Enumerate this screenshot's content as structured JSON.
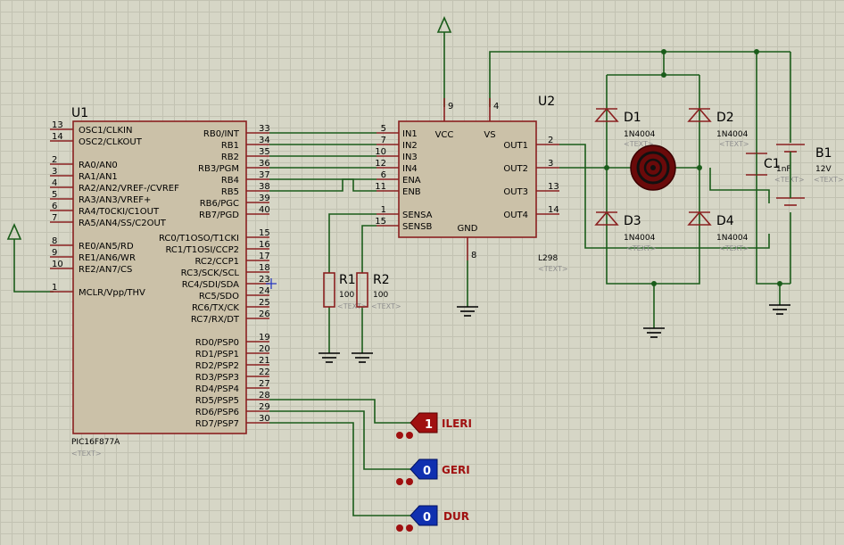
{
  "u1": {
    "ref": "U1",
    "part": "PIC16F877A",
    "text": "<TEXT>",
    "left_pins": [
      {
        "num": "13",
        "label": "OSC1/CLKIN"
      },
      {
        "num": "14",
        "label": "OSC2/CLKOUT"
      },
      {
        "num": "2",
        "label": "RA0/AN0"
      },
      {
        "num": "3",
        "label": "RA1/AN1"
      },
      {
        "num": "4",
        "label": "RA2/AN2/VREF-/CVREF"
      },
      {
        "num": "5",
        "label": "RA3/AN3/VREF+"
      },
      {
        "num": "6",
        "label": "RA4/T0CKI/C1OUT"
      },
      {
        "num": "7",
        "label": "RA5/AN4/SS/C2OUT"
      },
      {
        "num": "8",
        "label": "RE0/AN5/RD"
      },
      {
        "num": "9",
        "label": "RE1/AN6/WR"
      },
      {
        "num": "10",
        "label": "RE2/AN7/CS"
      },
      {
        "num": "1",
        "label": "MCLR/Vpp/THV"
      }
    ],
    "right_pins": [
      {
        "num": "33",
        "label": "RB0/INT"
      },
      {
        "num": "34",
        "label": "RB1"
      },
      {
        "num": "35",
        "label": "RB2"
      },
      {
        "num": "36",
        "label": "RB3/PGM"
      },
      {
        "num": "37",
        "label": "RB4"
      },
      {
        "num": "38",
        "label": "RB5"
      },
      {
        "num": "39",
        "label": "RB6/PGC"
      },
      {
        "num": "40",
        "label": "RB7/PGD"
      },
      {
        "num": "15",
        "label": "RC0/T1OSO/T1CKI"
      },
      {
        "num": "16",
        "label": "RC1/T1OSI/CCP2"
      },
      {
        "num": "17",
        "label": "RC2/CCP1"
      },
      {
        "num": "18",
        "label": "RC3/SCK/SCL"
      },
      {
        "num": "23",
        "label": "RC4/SDI/SDA"
      },
      {
        "num": "24",
        "label": "RC5/SDO"
      },
      {
        "num": "25",
        "label": "RC6/TX/CK"
      },
      {
        "num": "26",
        "label": "RC7/RX/DT"
      },
      {
        "num": "19",
        "label": "RD0/PSP0"
      },
      {
        "num": "20",
        "label": "RD1/PSP1"
      },
      {
        "num": "21",
        "label": "RD2/PSP2"
      },
      {
        "num": "22",
        "label": "RD3/PSP3"
      },
      {
        "num": "27",
        "label": "RD4/PSP4"
      },
      {
        "num": "28",
        "label": "RD5/PSP5"
      },
      {
        "num": "29",
        "label": "RD6/PSP6"
      },
      {
        "num": "30",
        "label": "RD7/PSP7"
      }
    ]
  },
  "u2": {
    "ref": "U2",
    "part": "L298",
    "text": "<TEXT>",
    "left_pins": [
      {
        "num": "5",
        "label": "IN1"
      },
      {
        "num": "7",
        "label": "IN2"
      },
      {
        "num": "10",
        "label": "IN3"
      },
      {
        "num": "12",
        "label": "IN4"
      },
      {
        "num": "6",
        "label": "ENA"
      },
      {
        "num": "11",
        "label": "ENB"
      },
      {
        "num": "1",
        "label": "SENSA"
      },
      {
        "num": "15",
        "label": "SENSB"
      }
    ],
    "right_pins": [
      {
        "num": "2",
        "label": "OUT1"
      },
      {
        "num": "3",
        "label": "OUT2"
      },
      {
        "num": "13",
        "label": "OUT3"
      },
      {
        "num": "14",
        "label": "OUT4"
      }
    ],
    "top_pins": [
      {
        "num": "9",
        "label": "VCC"
      },
      {
        "num": "4",
        "label": "VS"
      }
    ],
    "bottom_pins": [
      {
        "num": "8",
        "label": "GND"
      }
    ]
  },
  "resistors": [
    {
      "ref": "R1",
      "value": "100",
      "text": "<TEXT>"
    },
    {
      "ref": "R2",
      "value": "100",
      "text": "<TEXT>"
    }
  ],
  "diodes": [
    {
      "ref": "D1",
      "value": "1N4004",
      "text": "<TEXT>"
    },
    {
      "ref": "D2",
      "value": "1N4004",
      "text": "<TEXT>"
    },
    {
      "ref": "D3",
      "value": "1N4004",
      "text": "<TEXT>"
    },
    {
      "ref": "D4",
      "value": "1N4004",
      "text": "<TEXT>"
    }
  ],
  "capacitor": {
    "ref": "C1",
    "value": "1nF",
    "text": "<TEXT>"
  },
  "battery": {
    "ref": "B1",
    "value": "12V",
    "text": "<TEXT>"
  },
  "logic_states": [
    {
      "state": "1",
      "label": "ILERI",
      "color": "#a01010"
    },
    {
      "state": "0",
      "label": "GERI",
      "color": "#1030b0"
    },
    {
      "state": "0",
      "label": "DUR",
      "color": "#1030b0"
    }
  ],
  "colors": {
    "wire": "#1a5c1a",
    "component": "#8a2020",
    "body": "#cbc1a8",
    "background": "#d6d6c6"
  }
}
